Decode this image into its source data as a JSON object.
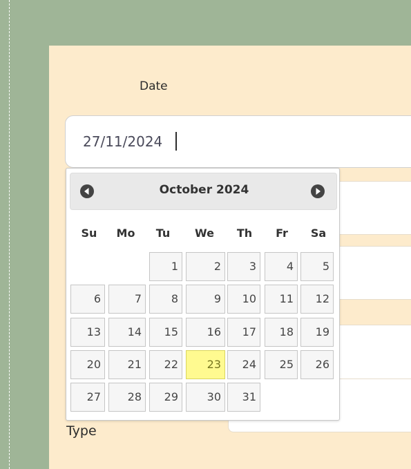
{
  "form": {
    "date_label": "Date",
    "date_value": "27/11/2024",
    "type_label": "Type"
  },
  "datepicker": {
    "month_year": "October 2024",
    "prev_icon": "circle-triangle-left-icon",
    "next_icon": "circle-triangle-right-icon",
    "weekdays": [
      "Su",
      "Mo",
      "Tu",
      "We",
      "Th",
      "Fr",
      "Sa"
    ],
    "first_weekday_index": 2,
    "days": [
      "1",
      "2",
      "3",
      "4",
      "5",
      "6",
      "7",
      "8",
      "9",
      "10",
      "11",
      "12",
      "13",
      "14",
      "15",
      "16",
      "17",
      "18",
      "19",
      "20",
      "21",
      "22",
      "23",
      "24",
      "25",
      "26",
      "27",
      "28",
      "29",
      "30",
      "31"
    ],
    "highlighted_day": "23"
  },
  "colors": {
    "background": "#9fb597",
    "panel": "#fdebcc",
    "today_highlight": "#fffa90"
  }
}
